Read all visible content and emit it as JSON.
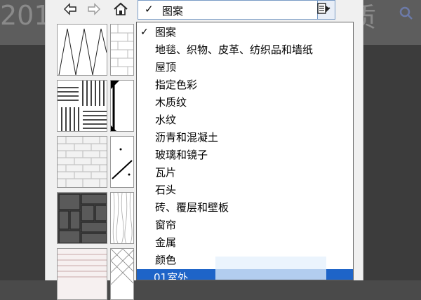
{
  "background": {
    "left_text": "201",
    "right_text": "质",
    "right_icon": "search-icon"
  },
  "toolbar": {
    "back_icon": "back-arrow-icon",
    "forward_icon": "forward-arrow-icon",
    "home_icon": "home-icon",
    "menu_icon": "menu-flyout-icon"
  },
  "combo": {
    "check": "✓",
    "value": "图案",
    "arrow_icon": "chevron-down-icon"
  },
  "dropdown": {
    "items": [
      {
        "label": "图案",
        "checked": true,
        "selected": false
      },
      {
        "label": "地毯、织物、皮革、纺织品和墙纸",
        "checked": false,
        "selected": false
      },
      {
        "label": "屋顶",
        "checked": false,
        "selected": false
      },
      {
        "label": "指定色彩",
        "checked": false,
        "selected": false
      },
      {
        "label": "木质纹",
        "checked": false,
        "selected": false
      },
      {
        "label": "水纹",
        "checked": false,
        "selected": false
      },
      {
        "label": "沥青和混凝土",
        "checked": false,
        "selected": false
      },
      {
        "label": "玻璃和镜子",
        "checked": false,
        "selected": false
      },
      {
        "label": "瓦片",
        "checked": false,
        "selected": false
      },
      {
        "label": "石头",
        "checked": false,
        "selected": false
      },
      {
        "label": "砖、覆层和壁板",
        "checked": false,
        "selected": false
      },
      {
        "label": "窗帘",
        "checked": false,
        "selected": false
      },
      {
        "label": "金属",
        "checked": false,
        "selected": false
      },
      {
        "label": "颜色",
        "checked": false,
        "selected": false
      },
      {
        "label": "01室外",
        "checked": false,
        "selected": true
      }
    ],
    "check_glyph": "✓"
  },
  "thumbnails": [
    {
      "name": "zigzag-pattern-thumb"
    },
    {
      "name": "light-brick-pattern-thumb"
    },
    {
      "name": "herringbone-pattern-thumb"
    },
    {
      "name": "corner-triangle-pattern-thumb"
    },
    {
      "name": "brick-pattern-thumb"
    },
    {
      "name": "diagonal-dash-pattern-thumb"
    },
    {
      "name": "dark-stone-pattern-thumb"
    },
    {
      "name": "wood-grain-pattern-thumb"
    },
    {
      "name": "roof-tile-pattern-thumb"
    },
    {
      "name": "crosshatch-pattern-thumb"
    }
  ],
  "colors": {
    "selection": "#1e64c8",
    "panel": "#f0f0f0",
    "combo_border": "#7a9cc6"
  }
}
